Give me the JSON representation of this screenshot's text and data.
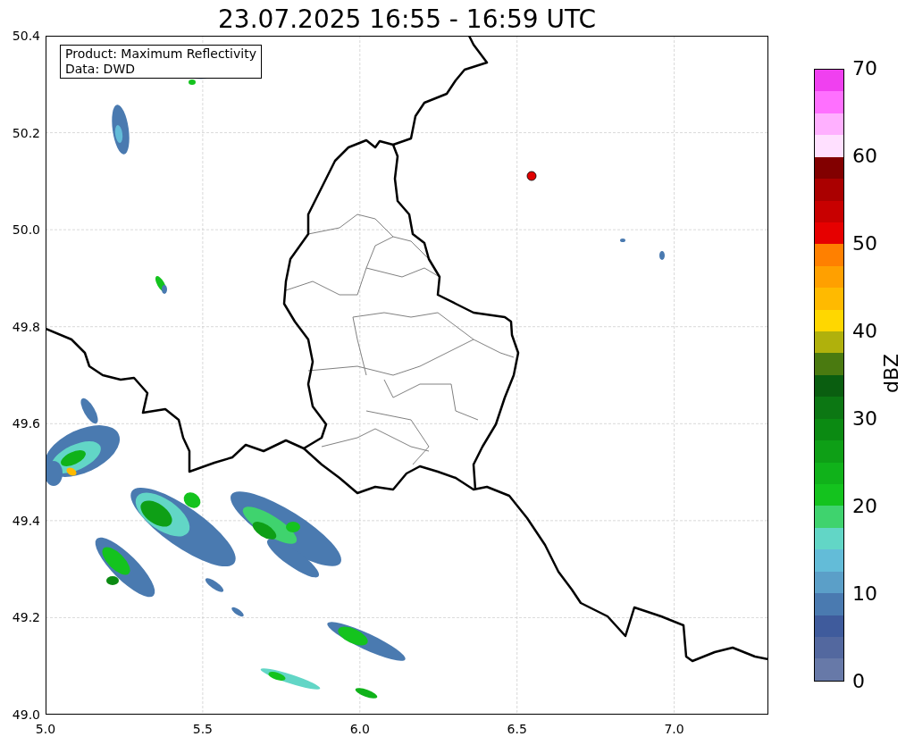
{
  "title": "23.07.2025 16:55 - 16:59 UTC",
  "legend": [
    "Product: Maximum Reflectivity",
    "Data: DWD"
  ],
  "x_ticks": [
    "5.0",
    "5.5",
    "6.0",
    "6.5",
    "7.0"
  ],
  "y_ticks": [
    "50.4",
    "50.2",
    "50.0",
    "49.8",
    "49.6",
    "49.4",
    "49.2",
    "49.0"
  ],
  "colorbar": {
    "label": "dBZ",
    "ticks": [
      "70",
      "60",
      "50",
      "40",
      "30",
      "20",
      "10",
      "0"
    ],
    "segments": [
      {
        "color": "#f040f0"
      },
      {
        "color": "#ff70ff"
      },
      {
        "color": "#ffb0ff"
      },
      {
        "color": "#ffe0ff"
      },
      {
        "color": "#820000"
      },
      {
        "color": "#aa0000"
      },
      {
        "color": "#c80000"
      },
      {
        "color": "#e60000"
      },
      {
        "color": "#ff8000"
      },
      {
        "color": "#ffa000"
      },
      {
        "color": "#ffba00"
      },
      {
        "color": "#ffd700"
      },
      {
        "color": "#b0b10c"
      },
      {
        "color": "#4a7a10"
      },
      {
        "color": "#0a5e10"
      },
      {
        "color": "#0c7713"
      },
      {
        "color": "#0b8a12"
      },
      {
        "color": "#0e9f16"
      },
      {
        "color": "#10b21a"
      },
      {
        "color": "#14c31e"
      },
      {
        "color": "#3fd36e"
      },
      {
        "color": "#62d6c6"
      },
      {
        "color": "#63bcd8"
      },
      {
        "color": "#5b9fc8"
      },
      {
        "color": "#4a7ab0"
      },
      {
        "color": "#3f5b9c"
      },
      {
        "color": "#53689f"
      },
      {
        "color": "#6779a8"
      }
    ]
  }
}
